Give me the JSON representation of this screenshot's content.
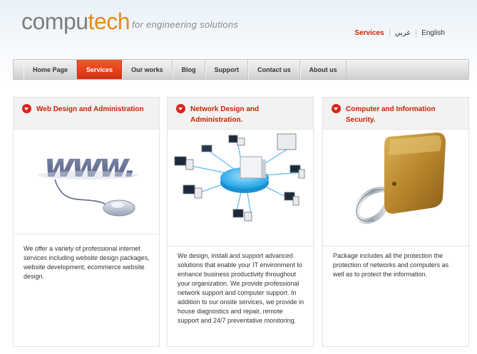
{
  "brand": {
    "logo_part1": "compu",
    "logo_part2": "tech",
    "tagline": "for engineering solutions"
  },
  "toplinks": [
    {
      "label": "Services",
      "active": true
    },
    {
      "label": "عربي",
      "active": false
    },
    {
      "label": "English",
      "active": false
    }
  ],
  "nav": {
    "items": [
      {
        "label": "Home Page"
      },
      {
        "label": "Services"
      },
      {
        "label": "Our works"
      },
      {
        "label": "Blog"
      },
      {
        "label": "Support"
      },
      {
        "label": "Contact us"
      },
      {
        "label": "About us"
      }
    ],
    "active_index": 1
  },
  "colors": {
    "accent": "#cc2200",
    "nav_active": "#e2401b",
    "logo_gray": "#7d7d7d",
    "logo_orange": "#e98b14"
  },
  "columns": [
    {
      "title": "Web Design and Administration",
      "image_icon": "www-mouse-illustration",
      "body": "We offer a variety of professional internet services including website design packages, website development, ecommerce website design."
    },
    {
      "title": "Network Design and Administration.",
      "image_icon": "network-diagram-illustration",
      "body": "We design, install and support advanced solutions that enable your IT environment to enhance business productivity throughout your organization. We provide professional network support and computer support. In addition to our onsite services, we provide in house diagnostics and repair, remote support and 24/7 preventative monitoring."
    },
    {
      "title": "Computer and Information Security.",
      "image_icon": "padlock-illustration",
      "body": "Package includes all the protection the protection of networks and computers as well as to protect the information."
    }
  ]
}
